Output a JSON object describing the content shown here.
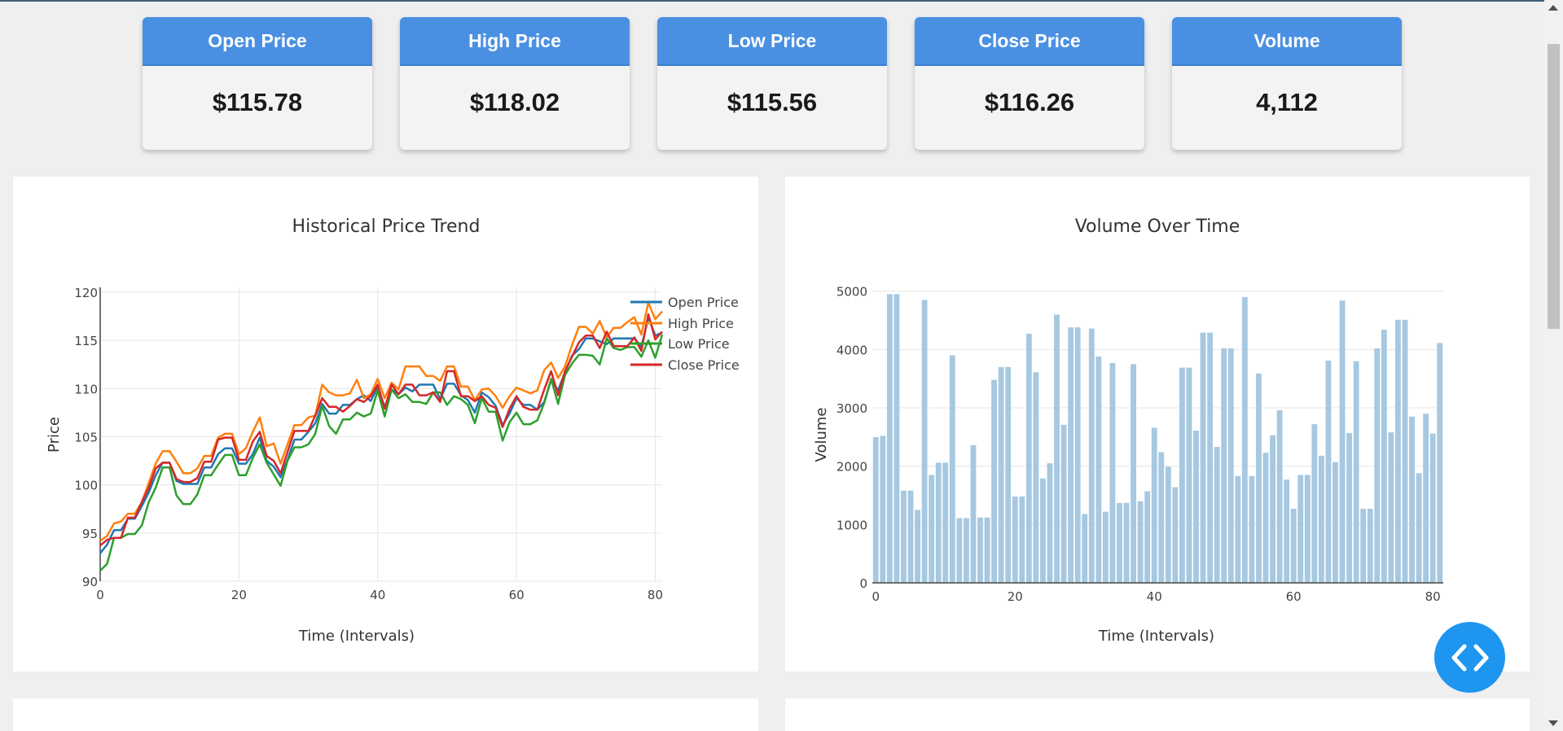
{
  "cards": [
    {
      "title": "Open Price",
      "value": "$115.78"
    },
    {
      "title": "High Price",
      "value": "$118.02"
    },
    {
      "title": "Low Price",
      "value": "$115.56"
    },
    {
      "title": "Close Price",
      "value": "$116.26"
    },
    {
      "title": "Volume",
      "value": "4,112"
    }
  ],
  "chart_data": [
    {
      "type": "line",
      "title": "Historical Price Trend",
      "xlabel": "Time (Intervals)",
      "ylabel": "Price",
      "xlim": [
        0,
        81
      ],
      "ylim": [
        90,
        120.5
      ],
      "xticks": [
        0,
        20,
        40,
        60,
        80
      ],
      "yticks": [
        90,
        95,
        100,
        105,
        110,
        115,
        120
      ],
      "grid": true,
      "legend_position": "right",
      "series": [
        {
          "name": "Open Price",
          "color": "#1f77b4",
          "values": [
            92.9,
            93.8,
            95.3,
            95.3,
            96.5,
            96.5,
            97.8,
            99.2,
            101.0,
            102.3,
            102.3,
            100.4,
            100.1,
            100.1,
            100.1,
            101.8,
            101.8,
            103.2,
            103.8,
            103.8,
            102.2,
            102.2,
            103.2,
            104.9,
            102.5,
            101.9,
            100.8,
            102.6,
            104.7,
            104.7,
            105.5,
            106.4,
            108.4,
            107.4,
            107.4,
            108.3,
            108.3,
            108.9,
            109.3,
            108.7,
            110.2,
            108.1,
            109.9,
            109.4,
            110.1,
            109.7,
            110.4,
            110.4,
            110.4,
            108.9,
            110.5,
            110.5,
            109.3,
            108.8,
            107.5,
            109.6,
            109.1,
            108.2,
            106.2,
            107.4,
            109.0,
            108.3,
            108.3,
            107.8,
            108.6,
            110.9,
            109.8,
            111.7,
            113.4,
            114.1,
            115.2,
            115.2,
            114.9,
            114.6,
            115.2,
            115.2,
            115.2,
            115.2,
            114.3,
            117.4,
            115.5,
            115.8
          ]
        },
        {
          "name": "High Price",
          "color": "#ff7f0e",
          "values": [
            94.2,
            94.7,
            96.0,
            96.2,
            97.0,
            97.0,
            98.2,
            100.2,
            102.2,
            103.5,
            103.5,
            102.4,
            101.2,
            101.2,
            101.7,
            103.0,
            103.0,
            104.9,
            105.3,
            105.3,
            103.2,
            103.8,
            105.5,
            107.0,
            104.0,
            104.3,
            102.2,
            104.2,
            106.2,
            106.2,
            107.0,
            107.2,
            110.4,
            109.6,
            109.3,
            109.3,
            109.5,
            110.9,
            109.0,
            109.4,
            111.0,
            109.0,
            110.6,
            109.9,
            112.3,
            112.3,
            112.3,
            111.3,
            111.3,
            110.8,
            112.3,
            112.3,
            110.2,
            110.2,
            108.8,
            109.9,
            110.0,
            109.2,
            108.0,
            109.2,
            110.1,
            109.8,
            109.5,
            109.8,
            111.9,
            112.7,
            111.1,
            112.3,
            114.5,
            116.4,
            116.4,
            115.7,
            117.0,
            115.3,
            116.3,
            116.3,
            116.9,
            117.4,
            115.6,
            118.9,
            117.2,
            118.0
          ]
        },
        {
          "name": "Low Price",
          "color": "#2ca02c",
          "values": [
            91.1,
            91.8,
            94.5,
            94.5,
            94.9,
            94.9,
            95.8,
            98.2,
            99.7,
            101.8,
            101.8,
            98.9,
            98.0,
            98.0,
            99.0,
            101.0,
            101.0,
            102.1,
            103.1,
            103.1,
            101.0,
            101.0,
            102.8,
            104.2,
            102.3,
            101.1,
            99.9,
            102.5,
            103.9,
            103.9,
            104.2,
            105.3,
            108.2,
            106.1,
            105.3,
            106.8,
            106.8,
            107.5,
            107.1,
            107.4,
            109.8,
            107.1,
            109.9,
            109.0,
            109.4,
            108.6,
            108.6,
            108.4,
            109.6,
            109.6,
            108.3,
            109.2,
            108.9,
            108.3,
            106.4,
            109.0,
            107.6,
            107.6,
            104.6,
            106.5,
            107.5,
            106.3,
            106.3,
            106.7,
            108.5,
            111.0,
            108.4,
            111.4,
            112.6,
            113.5,
            113.5,
            113.4,
            112.5,
            115.2,
            114.2,
            114.0,
            114.3,
            114.3,
            113.3,
            115.0,
            113.2,
            115.6
          ]
        },
        {
          "name": "Close Price",
          "color": "#d62728",
          "values": [
            93.7,
            94.3,
            94.5,
            94.5,
            96.6,
            96.6,
            98.2,
            99.7,
            101.7,
            102.3,
            102.3,
            100.6,
            100.3,
            100.3,
            100.7,
            102.4,
            102.4,
            104.7,
            104.9,
            104.9,
            102.6,
            102.6,
            104.5,
            105.5,
            103.0,
            102.5,
            101.2,
            103.4,
            105.6,
            105.6,
            105.6,
            107.2,
            109.0,
            108.1,
            108.1,
            107.6,
            108.2,
            108.9,
            108.6,
            109.2,
            110.4,
            107.9,
            110.4,
            109.4,
            110.4,
            110.4,
            109.3,
            109.3,
            109.6,
            108.6,
            111.8,
            111.8,
            109.2,
            109.2,
            108.7,
            109.2,
            108.3,
            108.0,
            106.0,
            107.9,
            109.2,
            108.1,
            107.8,
            107.8,
            109.9,
            111.8,
            109.3,
            111.8,
            113.3,
            114.8,
            115.5,
            115.5,
            114.2,
            115.9,
            114.4,
            114.4,
            114.4,
            115.3,
            113.9,
            117.7,
            115.1,
            115.9
          ]
        }
      ]
    },
    {
      "type": "bar",
      "title": "Volume Over Time",
      "xlabel": "Time (Intervals)",
      "ylabel": "Volume",
      "xlim": [
        -0.5,
        81.5
      ],
      "ylim": [
        0,
        5150
      ],
      "xticks": [
        0,
        20,
        40,
        60,
        80
      ],
      "yticks": [
        0,
        1000,
        2000,
        3000,
        4000,
        5000
      ],
      "grid": true,
      "color": "#a6c8e0",
      "values": [
        2500,
        2520,
        4950,
        4950,
        1580,
        1580,
        1250,
        4850,
        1850,
        2060,
        2060,
        3900,
        1110,
        1110,
        2360,
        1120,
        1120,
        3480,
        3700,
        3700,
        1480,
        1480,
        4270,
        3610,
        1790,
        2050,
        4600,
        2710,
        4380,
        4380,
        1180,
        4360,
        3880,
        1220,
        3770,
        1370,
        1370,
        3750,
        1400,
        1570,
        2660,
        2240,
        1990,
        1640,
        3690,
        3690,
        2610,
        4290,
        4290,
        2330,
        4020,
        4020,
        1830,
        4900,
        1830,
        3590,
        2230,
        2530,
        2960,
        1770,
        1270,
        1850,
        1850,
        2720,
        2180,
        3810,
        2070,
        4840,
        2570,
        3800,
        1270,
        1270,
        4020,
        4340,
        2580,
        4510,
        4510,
        2850,
        1880,
        2900,
        2560,
        4112
      ]
    }
  ],
  "fab": {
    "icon": "code-icon"
  }
}
